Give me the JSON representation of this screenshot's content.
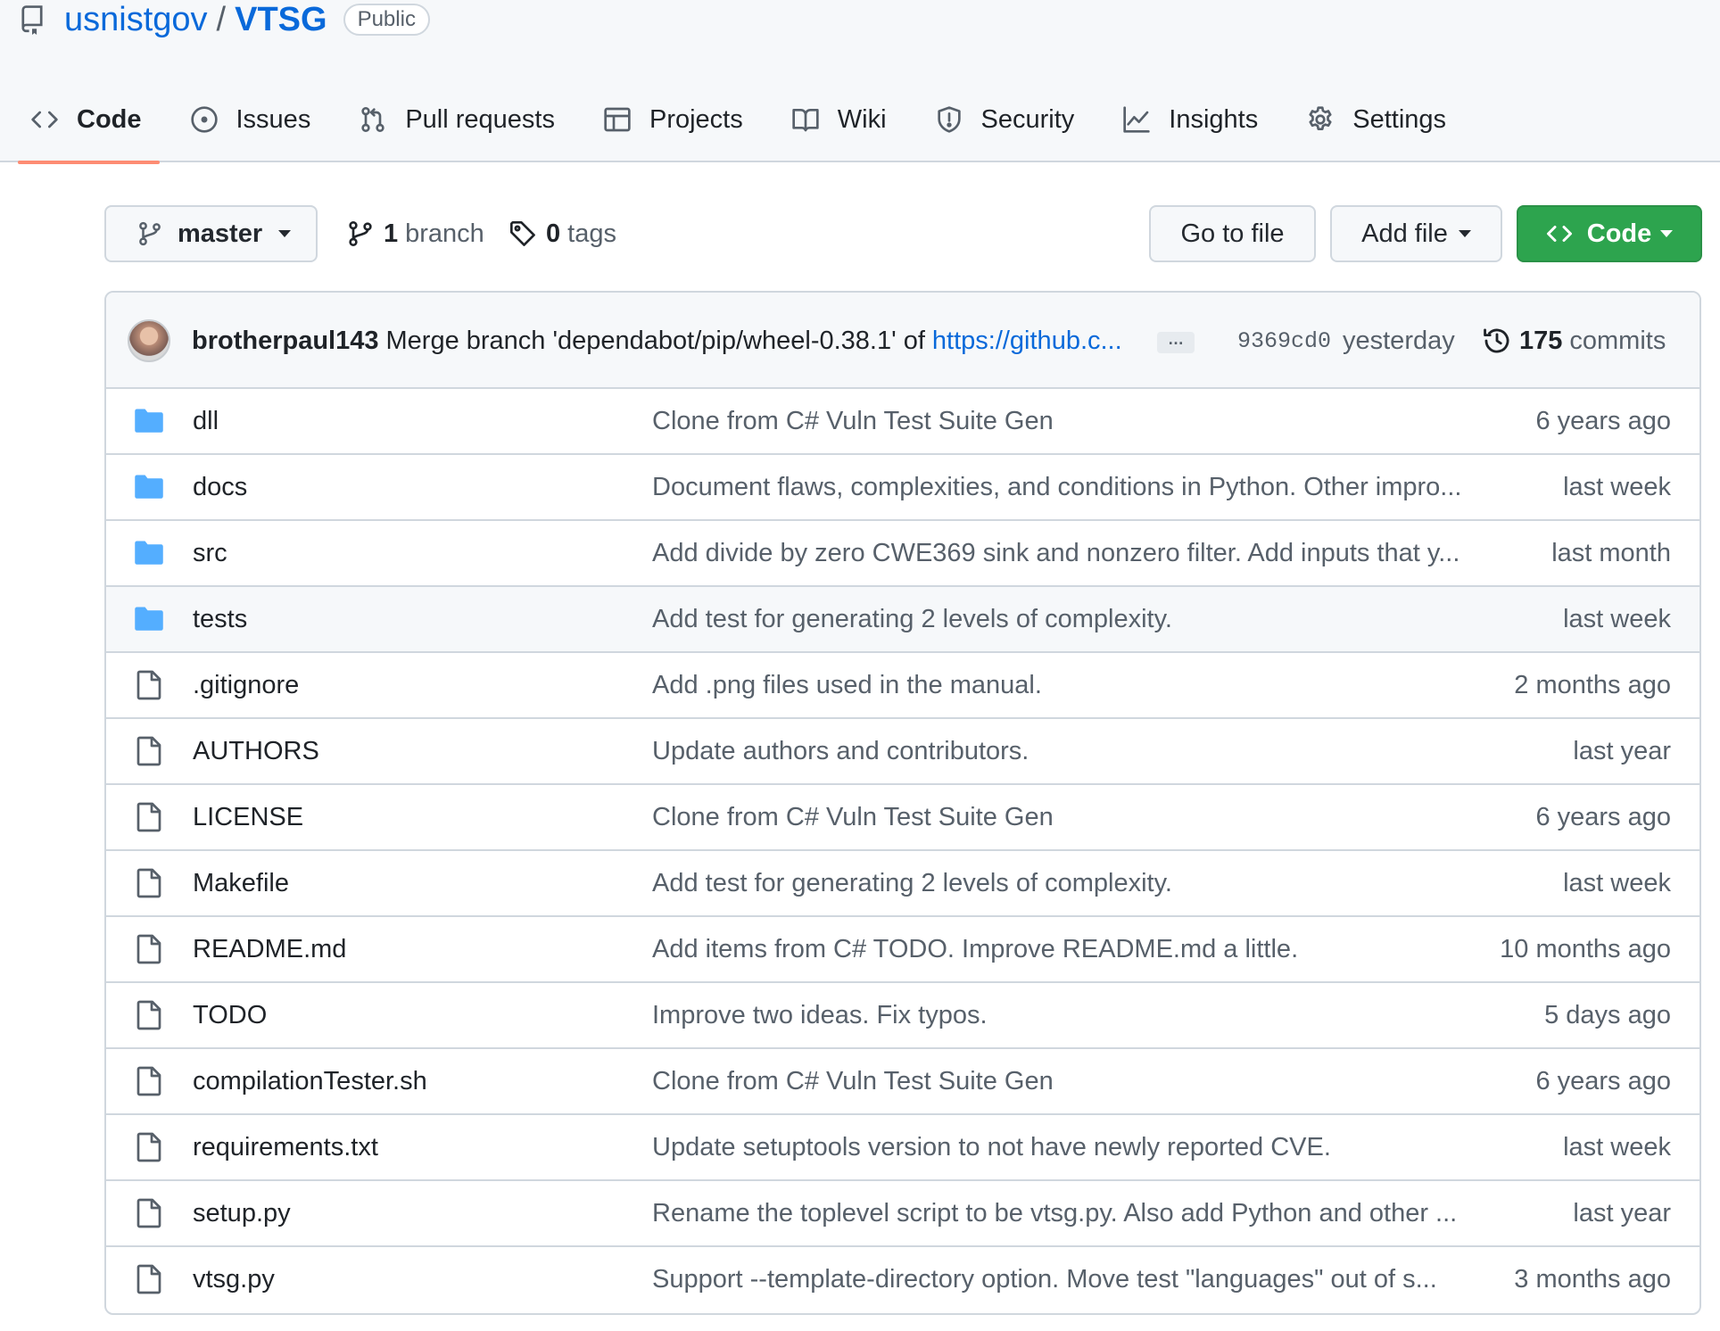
{
  "repo": {
    "owner": "usnistgov",
    "separator": "/",
    "name": "VTSG",
    "visibility": "Public"
  },
  "tabs": [
    {
      "label": "Code",
      "icon": "code-icon",
      "active": true
    },
    {
      "label": "Issues",
      "icon": "issue-icon"
    },
    {
      "label": "Pull requests",
      "icon": "pull-request-icon"
    },
    {
      "label": "Projects",
      "icon": "table-icon"
    },
    {
      "label": "Wiki",
      "icon": "book-icon"
    },
    {
      "label": "Security",
      "icon": "shield-icon"
    },
    {
      "label": "Insights",
      "icon": "graph-icon"
    },
    {
      "label": "Settings",
      "icon": "gear-icon"
    }
  ],
  "toolbar": {
    "branch_select": "master",
    "branch_count": "1",
    "branch_word": "branch",
    "tag_count": "0",
    "tag_word": "tags",
    "go_to_file": "Go to file",
    "add_file": "Add file",
    "code": "Code"
  },
  "latest_commit": {
    "author": "brotherpaul143",
    "message": "Merge branch 'dependabot/pip/wheel-0.38.1' of",
    "link": "https://github.c...",
    "ellipsis": "…",
    "sha": "9369cd0",
    "when": "yesterday",
    "commit_count": "175",
    "commit_word": "commits"
  },
  "files": [
    {
      "name": "dll",
      "type": "dir",
      "message": "Clone from C# Vuln Test Suite Gen",
      "age": "6 years ago"
    },
    {
      "name": "docs",
      "type": "dir",
      "message": "Document flaws, complexities, and conditions in Python. Other impro...",
      "age": "last week"
    },
    {
      "name": "src",
      "type": "dir",
      "message": "Add divide by zero CWE369 sink and nonzero filter. Add inputs that y...",
      "age": "last month"
    },
    {
      "name": "tests",
      "type": "dir",
      "message": "Add test for generating 2 levels of complexity.",
      "age": "last week"
    },
    {
      "name": ".gitignore",
      "type": "file",
      "message": "Add .png files used in the manual.",
      "age": "2 months ago"
    },
    {
      "name": "AUTHORS",
      "type": "file",
      "message": "Update authors and contributors.",
      "age": "last year"
    },
    {
      "name": "LICENSE",
      "type": "file",
      "message": "Clone from C# Vuln Test Suite Gen",
      "age": "6 years ago"
    },
    {
      "name": "Makefile",
      "type": "file",
      "message": "Add test for generating 2 levels of complexity.",
      "age": "last week"
    },
    {
      "name": "README.md",
      "type": "file",
      "message": "Add items from C# TODO. Improve README.md a little.",
      "age": "10 months ago"
    },
    {
      "name": "TODO",
      "type": "file",
      "message": "Improve two ideas. Fix typos.",
      "age": "5 days ago"
    },
    {
      "name": "compilationTester.sh",
      "type": "file",
      "message": "Clone from C# Vuln Test Suite Gen",
      "age": "6 years ago"
    },
    {
      "name": "requirements.txt",
      "type": "file",
      "message": "Update setuptools version to not have newly reported CVE.",
      "age": "last week"
    },
    {
      "name": "setup.py",
      "type": "file",
      "message": "Rename the toplevel script to be vtsg.py. Also add Python and other ...",
      "age": "last year"
    },
    {
      "name": "vtsg.py",
      "type": "file",
      "message": "Support --template-directory option. Move test \"languages\" out of s...",
      "age": "3 months ago"
    }
  ],
  "colors": {
    "link": "#0969da",
    "primary_button": "#2da44e",
    "folder": "#54aeff",
    "active_tab_underline": "#fd8c73"
  }
}
